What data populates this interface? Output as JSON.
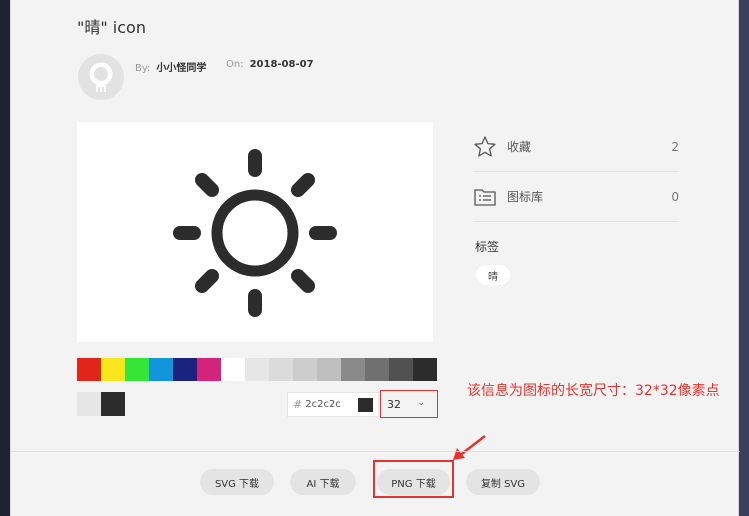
{
  "icon": {
    "title": "\"晴\" icon"
  },
  "author": {
    "by_label": "By:",
    "name": "小小怪同学",
    "on_label": "On:",
    "date": "2018-08-07"
  },
  "stats": [
    {
      "label": "收藏",
      "count": "2",
      "icon": "star-icon"
    },
    {
      "label": "图标库",
      "count": "0",
      "icon": "folder-list-icon"
    }
  ],
  "tags": {
    "title": "标签",
    "items": [
      "晴"
    ]
  },
  "palette": [
    "#e1251b",
    "#f8e71c",
    "#36e636",
    "#1296db",
    "#1a237e",
    "#d4237a",
    "#ffffff",
    "#e6e6e6",
    "#dbdbdb",
    "#cdcdcd",
    "#bfbfbf",
    "#8a8a8a",
    "#707070",
    "#515151",
    "#2c2c2c"
  ],
  "picked_colors": [
    "#e6e6e6",
    "#2c2c2c"
  ],
  "color_input": {
    "hash": "#",
    "value": "2c2c2c"
  },
  "size_select": {
    "value": "32",
    "chevron": "⌄"
  },
  "annotation": {
    "text": "该信息为图标的长宽尺寸：32*32像素点",
    "color": "#e3342f"
  },
  "buttons": [
    {
      "label": "SVG 下载"
    },
    {
      "label": "AI 下载"
    },
    {
      "label": "PNG 下载"
    },
    {
      "label": "复制 SVG"
    }
  ]
}
